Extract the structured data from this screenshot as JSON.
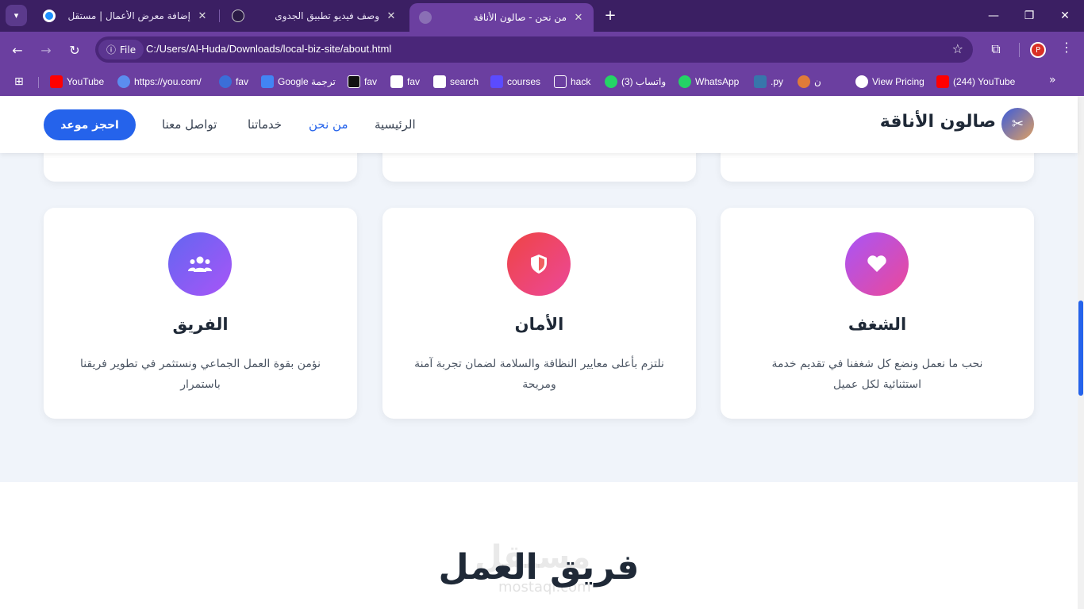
{
  "browser": {
    "tabs": [
      {
        "title": "إضافة معرض الأعمال | مستقل"
      },
      {
        "title": "وصف فيديو تطبيق الجدوى"
      },
      {
        "title": "من نحن - صالون الأناقة"
      }
    ],
    "new_tab": "+",
    "url_chip": "File",
    "url": "C:/Users/Al-Huda/Downloads/local-biz-site/about.html",
    "profile_initial": "P",
    "bookmarks": [
      {
        "label": "YouTube",
        "color": "#ff0000"
      },
      {
        "label": "https://you.com/",
        "color": "#5b8def"
      },
      {
        "label": "fav",
        "color": "#3b6ed8"
      },
      {
        "label": "Google ترجمة",
        "color": "#4285f4"
      },
      {
        "label": "fav",
        "color": "#111111"
      },
      {
        "label": "fav",
        "color": "#ffffff"
      },
      {
        "label": "search",
        "color": "#ffffff"
      },
      {
        "label": "courses",
        "color": "#5b4bff"
      },
      {
        "label": "hack",
        "color": "#6b3fa0"
      },
      {
        "label": "(3) واتساب",
        "color": "#25d366"
      },
      {
        "label": "WhatsApp",
        "color": "#25d366"
      },
      {
        "label": ".py",
        "color": "#3776ab"
      },
      {
        "label": "ن",
        "color": "#e07b39"
      },
      {
        "label": "View Pricing",
        "color": "#ffffff"
      },
      {
        "label": "(244) YouTube",
        "color": "#ff0000"
      }
    ]
  },
  "header": {
    "brand": "صالون الأناقة",
    "nav": {
      "home": "الرئيسية",
      "about": "من نحن",
      "services": "خدماتنا",
      "contact": "تواصل معنا"
    },
    "cta": "احجز موعد"
  },
  "values": [
    {
      "title": "الشغف",
      "text": "نحب ما نعمل ونضع كل شغفنا في تقديم خدمة استثنائية لكل عميل",
      "icon": "heart-icon",
      "colors": [
        "#a855f7",
        "#ec4899"
      ]
    },
    {
      "title": "الأمان",
      "text": "نلتزم بأعلى معايير النظافة والسلامة لضمان تجربة آمنة ومريحة",
      "icon": "shield-icon",
      "colors": [
        "#ef4444",
        "#ec4899"
      ]
    },
    {
      "title": "الفريق",
      "text": "نؤمن بقوة العمل الجماعي ونستثمر في تطوير فريقنا باستمرار",
      "icon": "users-icon",
      "colors": [
        "#6366f1",
        "#a855f7"
      ]
    }
  ],
  "team": {
    "title": "فريق العمل",
    "watermark": "مستقل",
    "watermark_sub": "mostaql.com"
  }
}
